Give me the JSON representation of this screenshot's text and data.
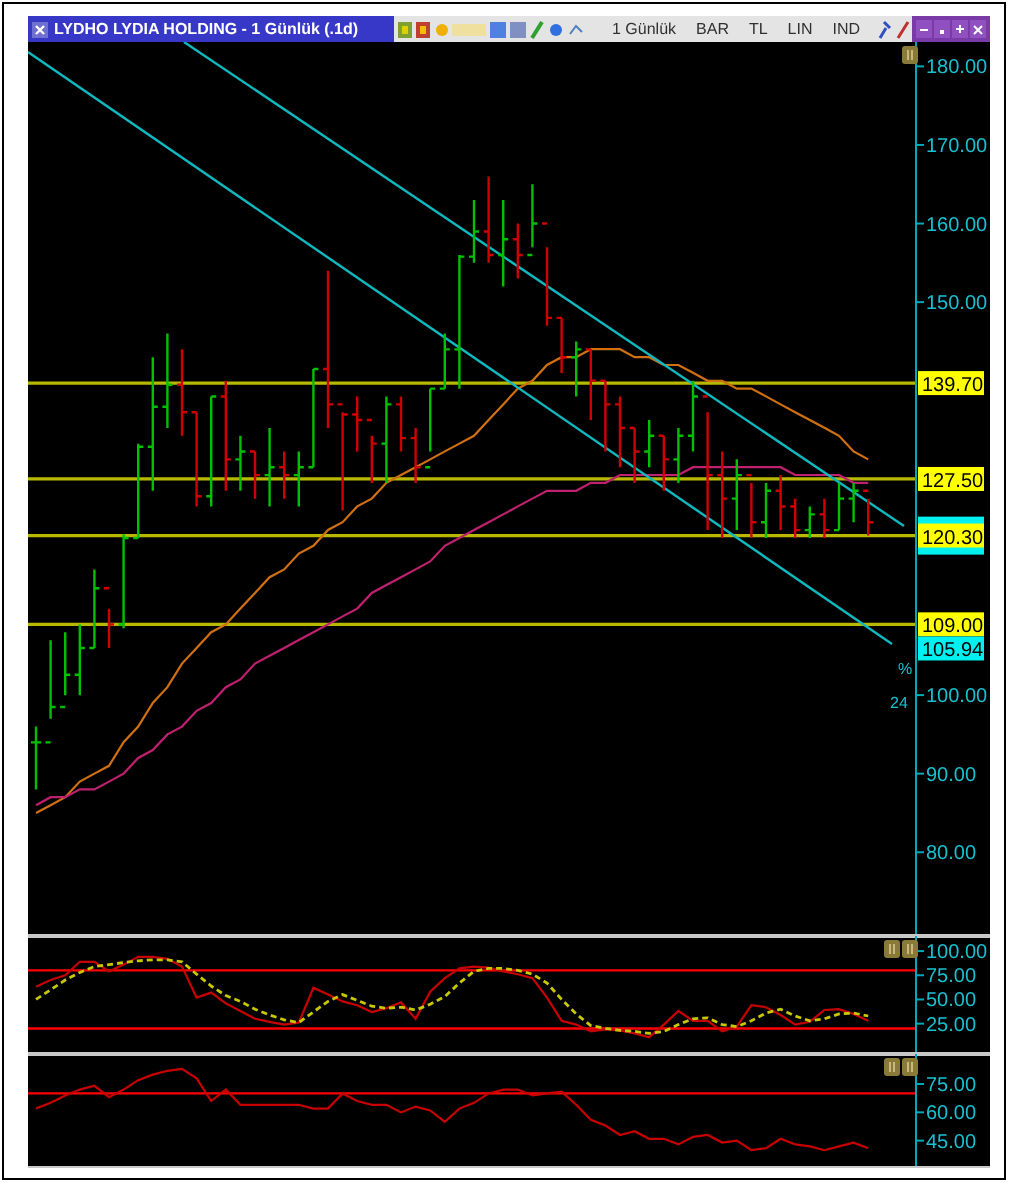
{
  "window": {
    "title": "LYDHO LYDIA HOLDING - 1 Günlük (.1d)",
    "toolbar": [
      "1 Günlük",
      "BAR",
      "TL",
      "LIN",
      "IND"
    ]
  },
  "price_chart": {
    "trend_label": "105.94",
    "line_tags": [
      "%",
      "24"
    ],
    "chart_data": {
      "type": "line",
      "series": [
        {
          "color": "#d07010",
          "values": [
            85,
            86,
            87,
            89,
            90,
            91,
            94,
            96,
            99,
            101,
            104,
            106,
            108,
            109,
            111,
            113,
            115,
            116,
            118,
            119,
            121,
            122,
            124,
            125,
            127,
            128,
            129,
            130,
            131,
            132,
            133,
            135,
            137,
            139,
            140,
            142,
            143,
            143,
            144,
            144,
            144,
            143,
            143,
            142,
            142,
            141,
            140,
            140,
            139,
            139,
            138,
            137,
            136,
            135,
            134,
            133,
            131,
            130
          ]
        },
        {
          "color": "#c02070",
          "values": [
            86,
            87,
            87,
            88,
            88,
            89,
            90,
            92,
            93,
            95,
            96,
            98,
            99,
            101,
            102,
            104,
            105,
            106,
            107,
            108,
            109,
            110,
            111,
            113,
            114,
            115,
            116,
            117,
            119,
            120,
            121,
            122,
            123,
            124,
            125,
            126,
            126,
            126,
            127,
            127,
            128,
            128,
            128,
            128,
            128,
            129,
            129,
            129,
            129,
            129,
            129,
            129,
            128,
            128,
            128,
            128,
            127,
            127
          ]
        }
      ],
      "yticks": [
        {
          "value": 80,
          "label": "80.00"
        },
        {
          "value": 90,
          "label": "90.00"
        },
        {
          "value": 100,
          "label": "100.00"
        },
        {
          "value": 150,
          "label": "150.00"
        },
        {
          "value": 160,
          "label": "160.00"
        },
        {
          "value": 170,
          "label": "170.00"
        },
        {
          "value": 180,
          "label": "180.00"
        }
      ],
      "ylim": [
        69.6,
        183.1
      ],
      "ref_lines": [
        {
          "axis": "y",
          "value": 139.7,
          "color": "#b8b800",
          "label": "139.70"
        },
        {
          "axis": "y",
          "value": 127.5,
          "color": "#b8b800",
          "label": "127.50"
        },
        {
          "axis": "y",
          "value": 120.3,
          "color": "#b8b800",
          "label": "120.30"
        },
        {
          "axis": "y",
          "value": 109,
          "color": "#b8b800",
          "label": "109.00"
        }
      ]
    }
  },
  "stochastic": {
    "chart_data": {
      "type": "line",
      "series": [
        {
          "color": "#c80000",
          "values": [
            63,
            70,
            75,
            89,
            89,
            79,
            86,
            94,
            94,
            92,
            84,
            52,
            57,
            46,
            38,
            30,
            27,
            24,
            26,
            62,
            55,
            48,
            44,
            37,
            41,
            47,
            30,
            58,
            72,
            82,
            84,
            83,
            79,
            76,
            72,
            52,
            28,
            24,
            17,
            19,
            18,
            15,
            11,
            24,
            38,
            28,
            28,
            17,
            22,
            44,
            42,
            34,
            24,
            27,
            39,
            40,
            35,
            28
          ]
        },
        {
          "color": "#c8c800",
          "line_style": "dashed",
          "values": [
            50,
            60,
            70,
            78,
            84,
            86,
            88,
            90,
            91,
            91,
            89,
            76,
            64,
            54,
            48,
            40,
            34,
            29,
            26,
            37,
            48,
            55,
            49,
            43,
            41,
            42,
            39,
            45,
            53,
            67,
            79,
            82,
            82,
            80,
            76,
            67,
            50,
            35,
            23,
            20,
            18,
            17,
            15,
            17,
            24,
            30,
            31,
            24,
            22,
            28,
            36,
            40,
            33,
            28,
            30,
            35,
            36,
            33
          ]
        }
      ],
      "yticks": [
        {
          "value": 100,
          "label": "100.00"
        },
        {
          "value": 75,
          "label": "75.00"
        },
        {
          "value": 50,
          "label": "50.00"
        },
        {
          "value": 25,
          "label": "25.00"
        }
      ],
      "ylim": [
        -4.3,
        113.5
      ],
      "ref_lines": [
        {
          "axis": "y",
          "value": 80,
          "color": "#ff0000"
        },
        {
          "axis": "y",
          "value": 20,
          "color": "#ff0000"
        }
      ]
    }
  },
  "rsi": {
    "chart_data": {
      "type": "line",
      "series": [
        {
          "color": "#c80000",
          "values": [
            62,
            65,
            69,
            72,
            74,
            68,
            72,
            77,
            80,
            82,
            83,
            78,
            66,
            72,
            64,
            64,
            64,
            64,
            64,
            62,
            62,
            70,
            66,
            64,
            64,
            60,
            63,
            61,
            55,
            62,
            65,
            70,
            72,
            72,
            69,
            70,
            71,
            64,
            56,
            53,
            48,
            50,
            46,
            46,
            43,
            47,
            48,
            44,
            45,
            40,
            41,
            46,
            43,
            42,
            40,
            42,
            44,
            41
          ]
        }
      ],
      "yticks": [
        {
          "value": 75,
          "label": "75.00"
        },
        {
          "value": 60,
          "label": "60.00"
        },
        {
          "value": 45,
          "label": "45.00"
        }
      ],
      "ylim": [
        31.6,
        89.8
      ],
      "ref_lines": [
        {
          "axis": "y",
          "value": 70,
          "color": "#ff0000"
        }
      ]
    }
  }
}
